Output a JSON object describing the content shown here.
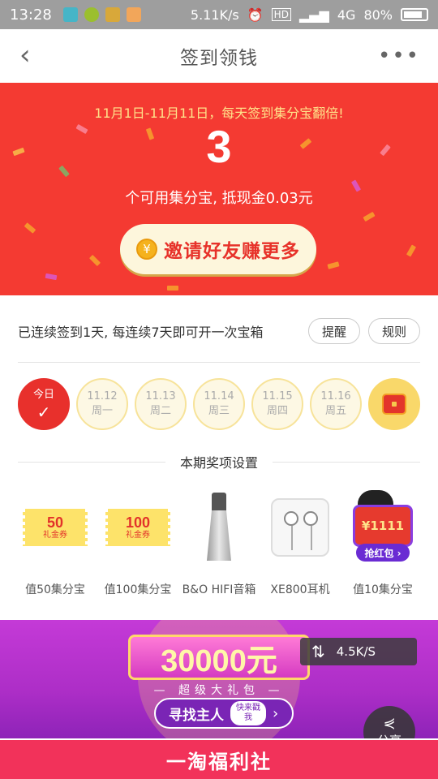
{
  "status_bar": {
    "time": "13:28",
    "net_speed": "5.11K/s",
    "hd": "HD",
    "network": "4G",
    "battery": "80%"
  },
  "nav": {
    "back_icon": "‹",
    "title": "签到领钱",
    "more_icon": "•••"
  },
  "banner": {
    "promo": "11月1日-11月11日，每天签到集分宝翻倍!",
    "count": "3",
    "desc": "个可用集分宝, 抵现金0.03元",
    "invite_icon": "¥",
    "invite_label": "邀请好友赚更多"
  },
  "streak": {
    "text": "已连续签到1天, 每连续7天即可开一次宝箱",
    "remind_label": "提醒",
    "rules_label": "规则"
  },
  "days": [
    {
      "top": "今日",
      "bottom": "✓"
    },
    {
      "top": "11.12",
      "bottom": "周一"
    },
    {
      "top": "11.13",
      "bottom": "周二"
    },
    {
      "top": "11.14",
      "bottom": "周三"
    },
    {
      "top": "11.15",
      "bottom": "周四"
    },
    {
      "top": "11.16",
      "bottom": "周五"
    }
  ],
  "prize_section": {
    "title": "本期奖项设置",
    "prizes": [
      {
        "coupon_value": "50",
        "coupon_sub": "礼金券",
        "label": "值50集分宝"
      },
      {
        "coupon_value": "100",
        "coupon_sub": "礼金券",
        "label": "值100集分宝"
      },
      {
        "label": "B&O HIFI音箱"
      },
      {
        "label": "XE800耳机"
      },
      {
        "hb_value": "¥1111",
        "hb_button": "抢红包 ›",
        "label": "值10集分宝"
      }
    ]
  },
  "promo_banner": {
    "amount": "30000元",
    "subtitle": "— 超级大礼包 —",
    "find_label": "寻找主人",
    "find_sub": "快来戳我",
    "find_arrow": "›"
  },
  "overlay": {
    "speed_icon": "⇅",
    "speed": "4.5K/S"
  },
  "share": {
    "icon": "⋞",
    "label": "分享"
  },
  "fuli_banner": {
    "label": "一淘福利社"
  }
}
